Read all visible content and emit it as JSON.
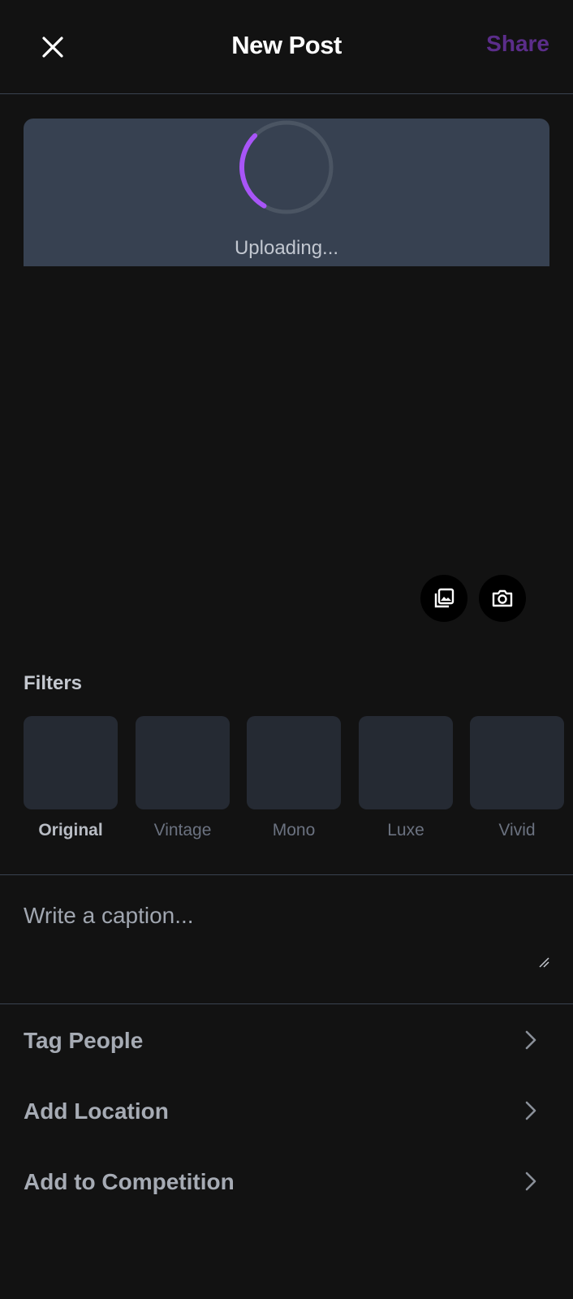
{
  "header": {
    "title": "New Post",
    "share_label": "Share",
    "share_color": "#5b2d8a"
  },
  "upload": {
    "status_text": "Uploading...",
    "spinner_color": "#a855f7",
    "track_color": "#4b5563"
  },
  "media_buttons": [
    {
      "icon": "gallery-icon"
    },
    {
      "icon": "camera-icon"
    }
  ],
  "filters": {
    "label": "Filters",
    "items": [
      {
        "name": "Original",
        "selected": true
      },
      {
        "name": "Vintage",
        "selected": false
      },
      {
        "name": "Mono",
        "selected": false
      },
      {
        "name": "Luxe",
        "selected": false
      },
      {
        "name": "Vivid",
        "selected": false
      }
    ]
  },
  "caption": {
    "placeholder": "Write a caption..."
  },
  "options": [
    {
      "label": "Tag People"
    },
    {
      "label": "Add Location"
    },
    {
      "label": "Add to Competition"
    }
  ]
}
